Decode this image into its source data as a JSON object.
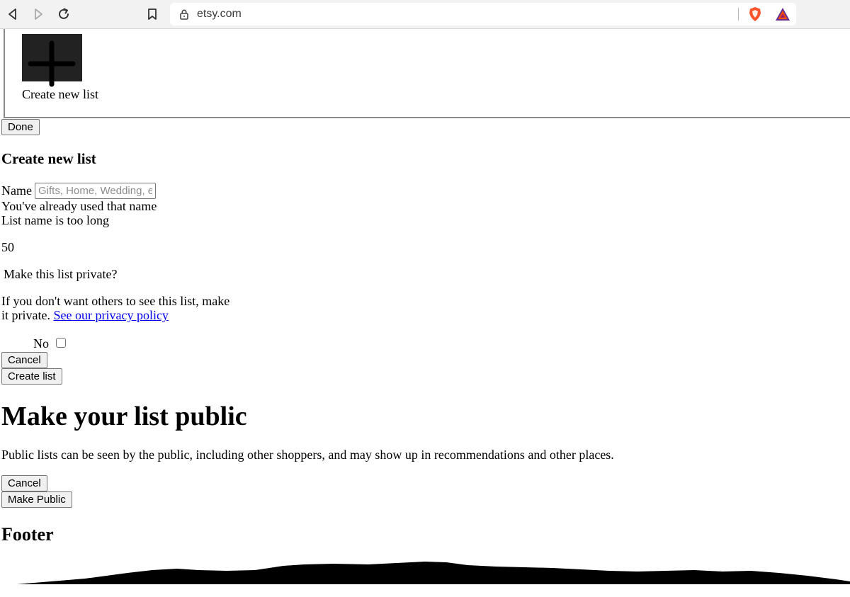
{
  "browser": {
    "url": "etsy.com",
    "icons": [
      "back-icon",
      "forward-icon",
      "reload-icon",
      "bookmark-icon",
      "lock-icon",
      "brave-shield-icon",
      "bat-rewards-icon"
    ]
  },
  "lists_panel": {
    "tile_icon": "plus-icon",
    "create_new_list_caption": "Create new list",
    "done_label": "Done"
  },
  "create_list_form": {
    "heading": "Create new list",
    "name_label": "Name",
    "name_value": "",
    "name_placeholder": "Gifts, Home, Wedding, etc.",
    "error_duplicate": "You've already used that name",
    "error_too_long": "List name is too long",
    "char_limit": "50",
    "private_question": "Make this list private?",
    "private_help_line1": "If you don't want others to see this list, make",
    "private_help_line2": "it private. ",
    "privacy_link": "See our privacy policy",
    "toggle_label": "No",
    "toggle_checked": false,
    "cancel_label": "Cancel",
    "create_label": "Create list"
  },
  "make_public_dialog": {
    "heading": "Make your list public",
    "body": "Public lists can be seen by the public, including other shoppers, and may show up in recommendations and other places.",
    "cancel_label": "Cancel",
    "make_public_label": "Make Public"
  },
  "footer": {
    "heading": "Footer"
  }
}
